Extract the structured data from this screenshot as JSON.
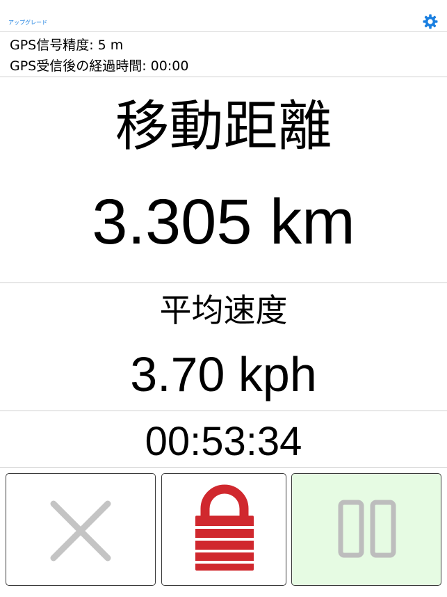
{
  "header": {
    "upgrade_label": "アップグレード",
    "settings_icon": "gear-icon"
  },
  "gps": {
    "accuracy_text": "GPS信号精度: 5 m",
    "elapsed_text": "GPS受信後の経過時間: 00:00"
  },
  "distance": {
    "label": "移動距離",
    "value": "3.305 km"
  },
  "speed": {
    "label": "平均速度",
    "value": "3.70 kph"
  },
  "timer": {
    "value": "00:53:34"
  },
  "controls": {
    "cancel_icon": "x-icon",
    "lock_icon": "lock-icon",
    "pause_icon": "pause-icon"
  },
  "colors": {
    "accent": "#1a7fe0",
    "lock_red": "#d0282e",
    "pause_bg": "#e6fbe3"
  }
}
